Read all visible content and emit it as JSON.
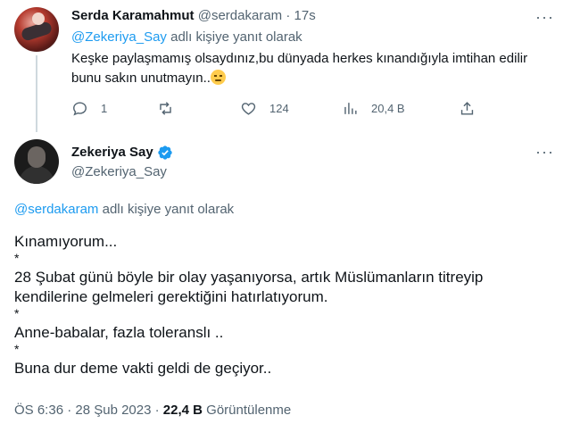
{
  "reply": {
    "author_name": "Serda Karamahmut",
    "handle": "@serdakaram",
    "separator": "·",
    "time": "17s",
    "reply_to_mention": "@Zekeriya_Say",
    "reply_to_suffix": "adlı kişiye yanıt olarak",
    "text": "Keşke paylaşmamış olsaydınız,bu dünyada herkes kınandığıyla imtihan edilir bunu sakın unutmayın..",
    "emoji_icon": "pensive-face-emoji",
    "more_label": "···",
    "actions": {
      "reply_count": "1",
      "retweet_count": "",
      "like_count": "124",
      "views_count": "20,4 B",
      "share_count": ""
    }
  },
  "main": {
    "author_name": "Zekeriya Say",
    "handle": "@Zekeriya_Say",
    "verified": true,
    "more_label": "···",
    "reply_to_mention": "@serdakaram",
    "reply_to_suffix": "adlı kişiye yanıt olarak",
    "lines": [
      "Kınamıyorum...",
      "*",
      "28 Şubat günü böyle bir olay yaşanıyorsa, artık Müslümanların titreyip kendilerine gelmeleri gerektiğini hatırlatıyorum.",
      "*",
      "Anne-babalar, fazla toleranslı ..",
      "*",
      "Buna dur deme vakti geldi de geçiyor.."
    ],
    "timestamp": "ÖS 6:36 · 28 Şub 2023 ·",
    "views_count": "22,4 B",
    "views_label": "Görüntülenme"
  },
  "colors": {
    "accent": "#1d9bf0",
    "text": "#0f1419",
    "secondary": "#536471",
    "divider": "#eff3f4"
  }
}
